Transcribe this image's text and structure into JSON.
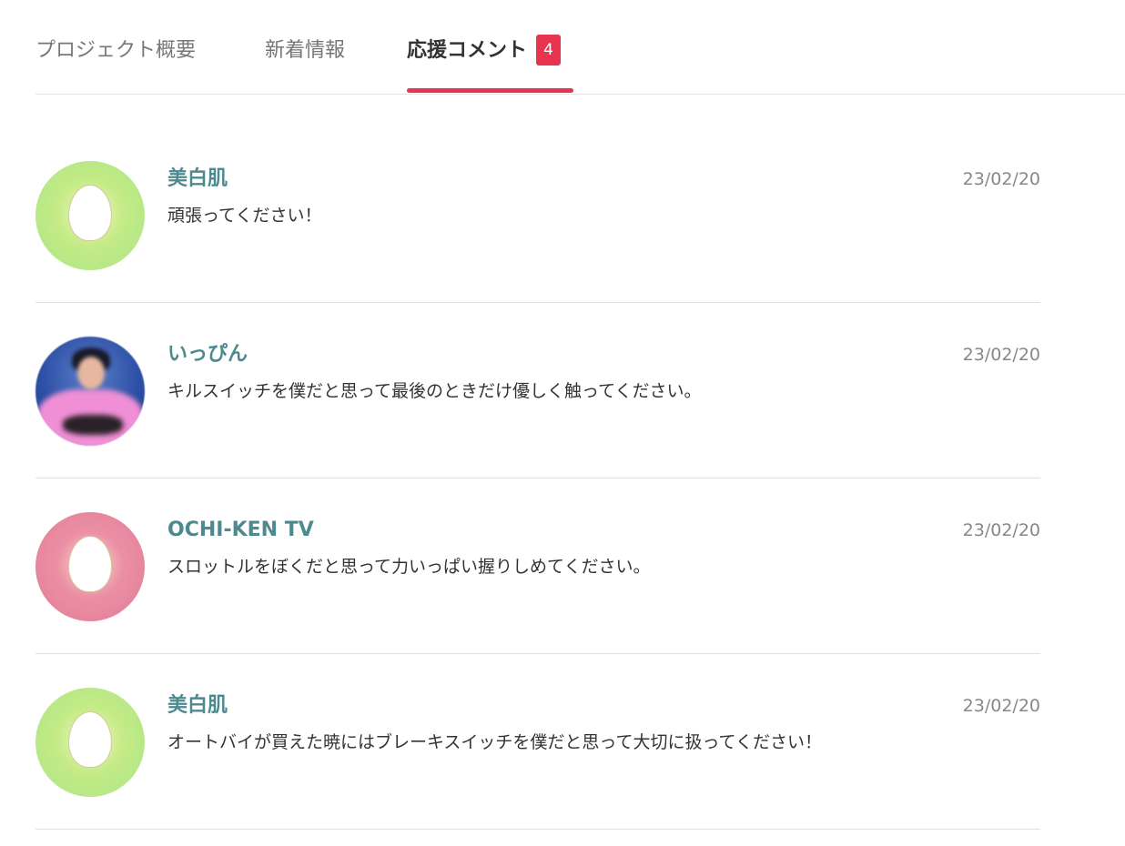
{
  "tabs": [
    {
      "label": "プロジェクト概要"
    },
    {
      "label": "新着情報"
    },
    {
      "label": "応援コメント",
      "badge": "4",
      "active": true
    }
  ],
  "colors": {
    "accent": "#e8344e",
    "author": "#4d8a8f"
  },
  "comments": [
    {
      "author": "美白肌",
      "date": "23/02/20",
      "text": "頑張ってください！",
      "avatar": "default-avatar-icon-green"
    },
    {
      "author": "いっぴん",
      "date": "23/02/20",
      "text": "キルスイッチを僕だと思って最後のときだけ優しく触ってください。",
      "avatar": "user-photo"
    },
    {
      "author": "OCHI-KEN TV",
      "date": "23/02/20",
      "text": "スロットルをぼくだと思って力いっぱい握りしめてください。",
      "avatar": "default-avatar-icon-pink"
    },
    {
      "author": "美白肌",
      "date": "23/02/20",
      "text": "オートバイが買えた暁にはブレーキスイッチを僕だと思って大切に扱ってください！",
      "avatar": "default-avatar-icon-green"
    }
  ]
}
